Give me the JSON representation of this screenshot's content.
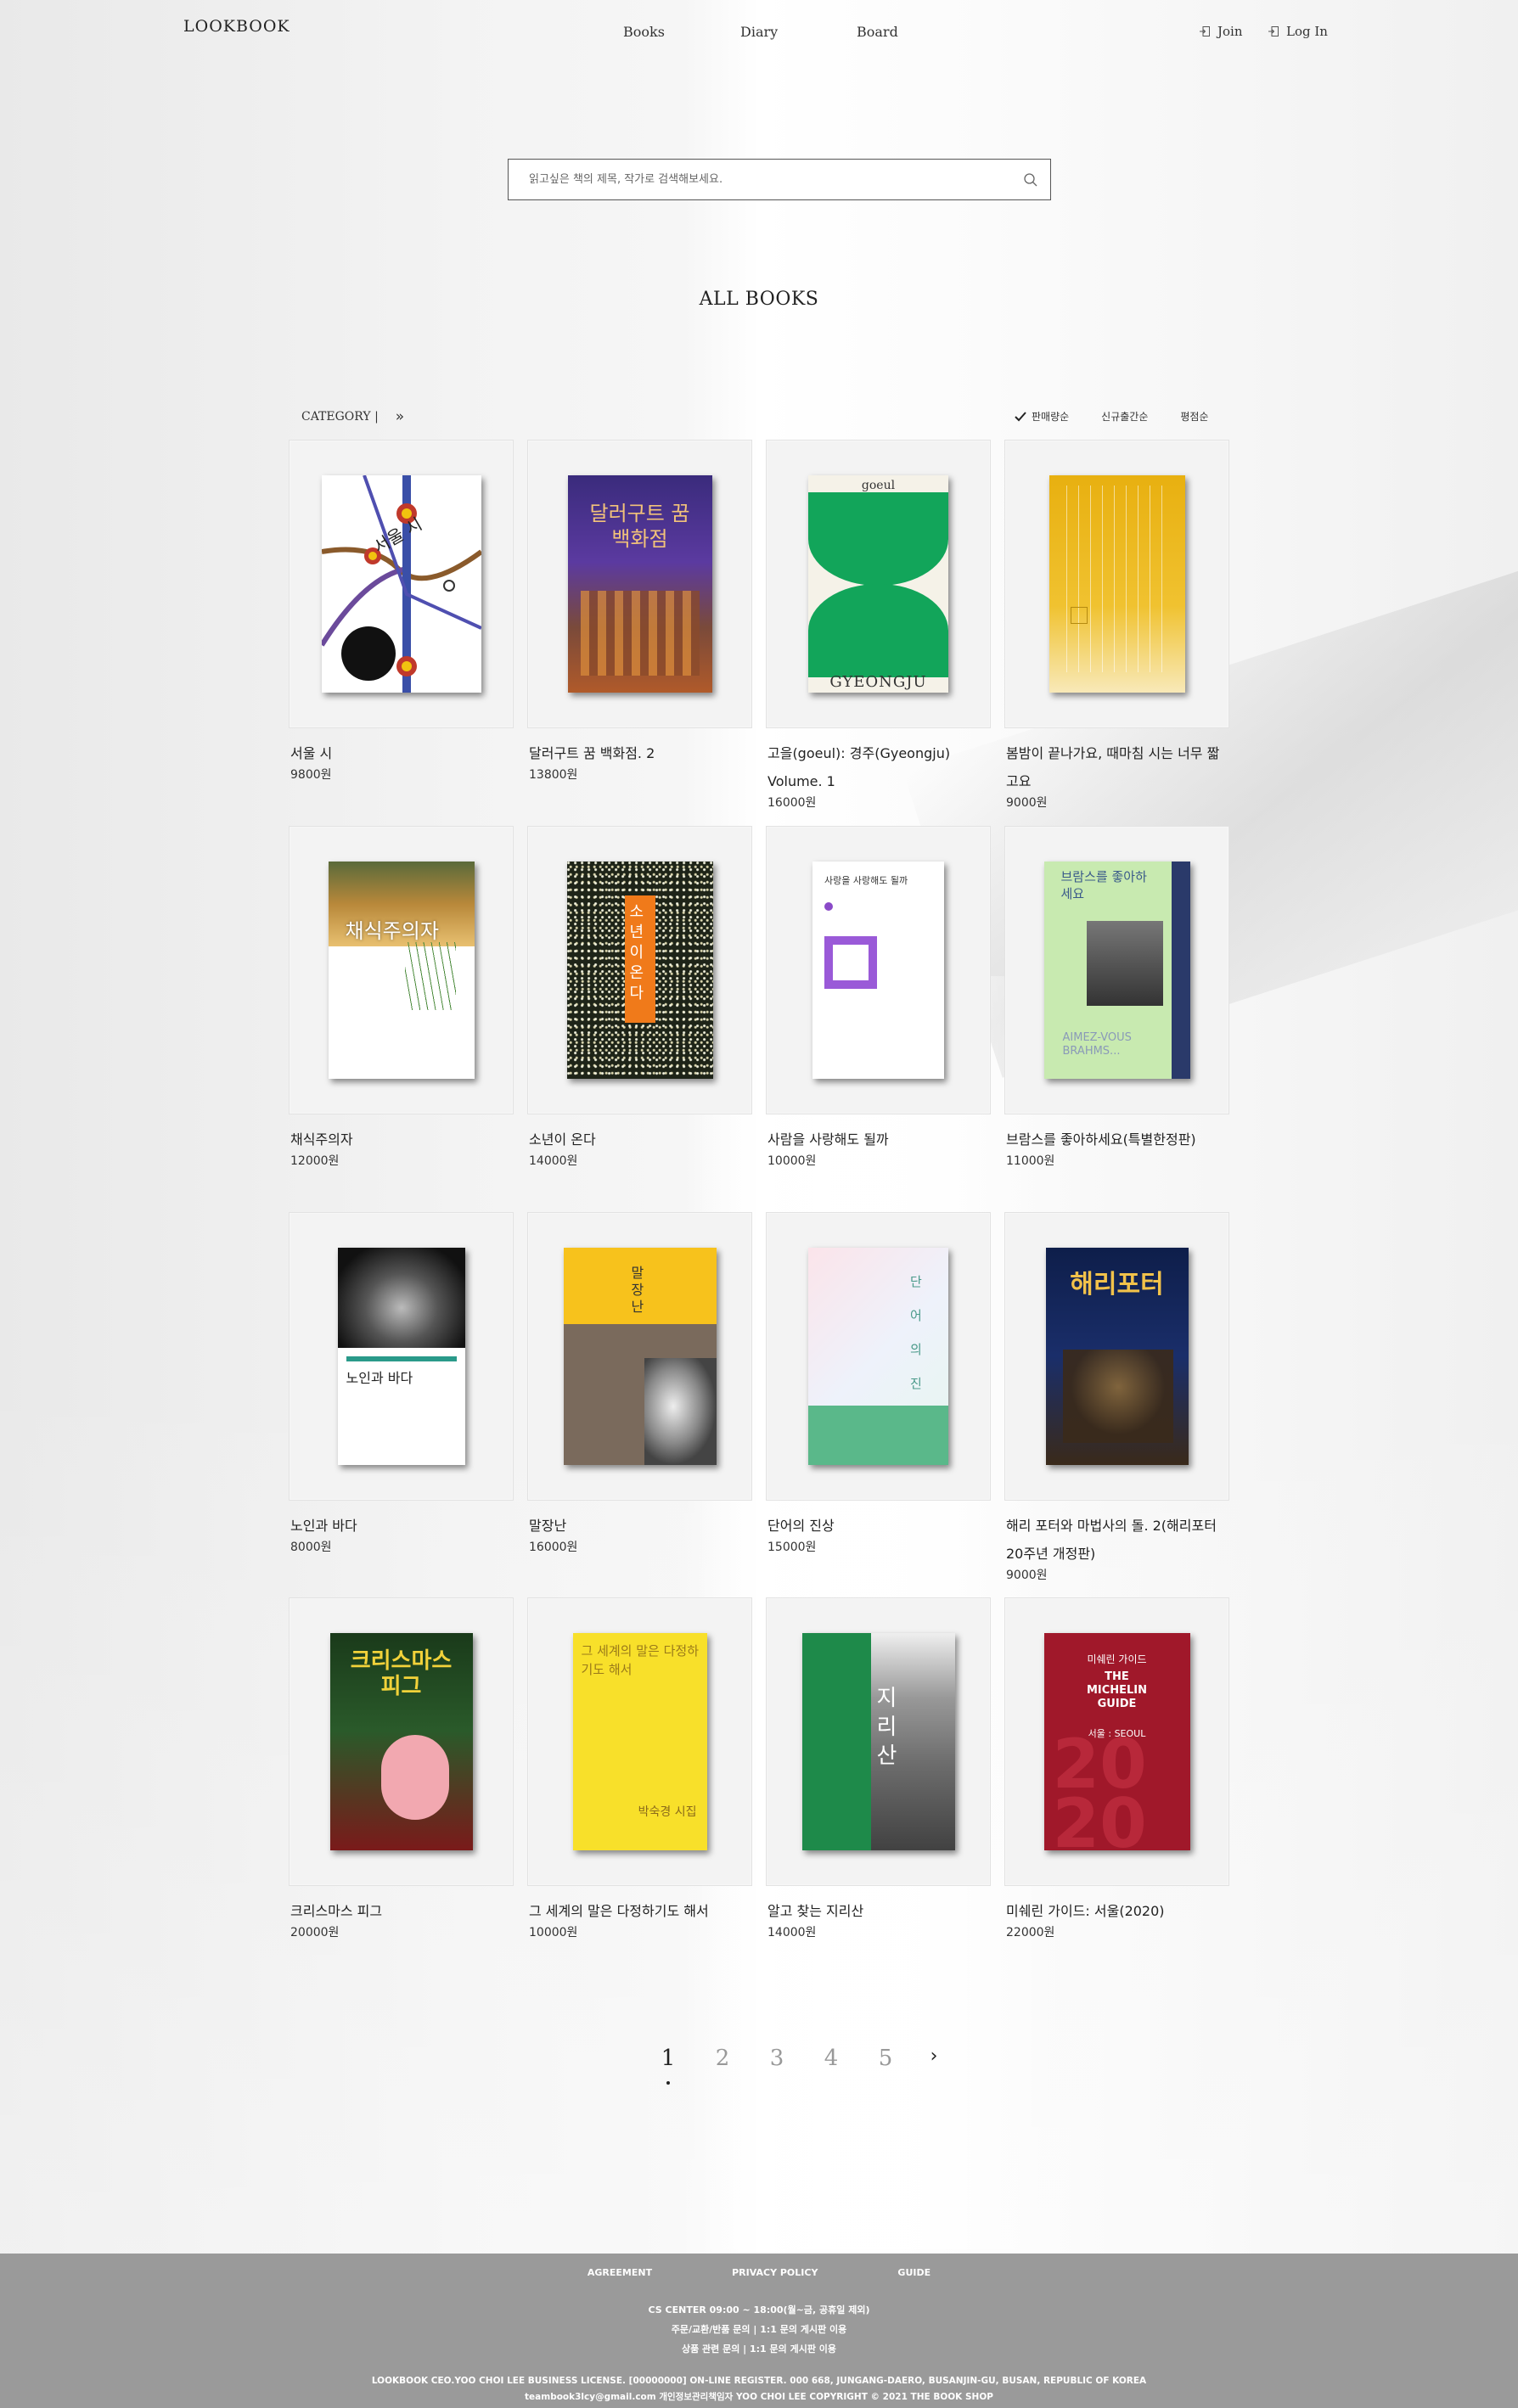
{
  "header": {
    "logo": "LOOKBOOK",
    "nav": [
      "Books",
      "Diary",
      "Board"
    ],
    "join": "Join",
    "login": "Log In"
  },
  "search": {
    "placeholder": "읽고싶은 책의 제목, 작가로 검색해보세요."
  },
  "section_title": "ALL BOOKS",
  "category": {
    "label": "CATEGORY |",
    "arrow": "»"
  },
  "sorts": [
    {
      "label": "판매량순",
      "selected": true
    },
    {
      "label": "신규출간순",
      "selected": false
    },
    {
      "label": "평점순",
      "selected": false
    }
  ],
  "books": [
    {
      "title": "서울 시",
      "price": "9800원",
      "cover": "seoul"
    },
    {
      "title": "달러구트 꿈 백화점. 2",
      "price": "13800원",
      "cover": "dallergut"
    },
    {
      "title": "고을(goeul): 경주(Gyeongju) Volume. 1",
      "price": "16000원",
      "cover": "gyeongju"
    },
    {
      "title": "봄밤이 끝나가요, 때마침 시는 너무 짧고요",
      "price": "9000원",
      "cover": "spring"
    },
    {
      "title": "채식주의자",
      "price": "12000원",
      "cover": "vegetarian"
    },
    {
      "title": "소년이 온다",
      "price": "14000원",
      "cover": "boy"
    },
    {
      "title": "사람을 사랑해도 될까",
      "price": "10000원",
      "cover": "love"
    },
    {
      "title": "브람스를 좋아하세요(특별한정판)",
      "price": "11000원",
      "cover": "brahms"
    },
    {
      "title": "노인과 바다",
      "price": "8000원",
      "cover": "oldman"
    },
    {
      "title": "말장난",
      "price": "16000원",
      "cover": "pun"
    },
    {
      "title": "단어의 진상",
      "price": "15000원",
      "cover": "words"
    },
    {
      "title": "해리 포터와 마법사의 돌. 2(해리포터 20주년 개정판)",
      "price": "9000원",
      "cover": "harry"
    },
    {
      "title": "크리스마스 피그",
      "price": "20000원",
      "cover": "pig"
    },
    {
      "title": "그 세계의 말은 다정하기도 해서",
      "price": "10000원",
      "cover": "world"
    },
    {
      "title": "알고 찾는 지리산",
      "price": "14000원",
      "cover": "jirisan"
    },
    {
      "title": "미쉐린 가이드: 서울(2020)",
      "price": "22000원",
      "cover": "michelin"
    }
  ],
  "covers_text": {
    "seoul_title": "서울 시",
    "dallergut_title": "달러구트 꿈 백화점",
    "gyeongju_top": "goeul",
    "gyeongju_bottom": "GYEONGJU",
    "vegetarian_title": "채식주의자",
    "boy_title": "소년이 온다",
    "love_title": "사랑을 사랑해도 될까",
    "brahms_title": "브람스를 좋아하세요",
    "brahms_sub": "AIMEZ-VOUS BRAHMS...",
    "oldman_title": "노인과 바다",
    "pun_title": "말장난",
    "words_title": "단어의 진상",
    "harry_title": "해리포터",
    "pig_title": "크리스마스 피그",
    "world_title": "그 세계의 말은 다정하기도 해서",
    "world_author": "박숙경 시집",
    "jirisan_title": "지리산",
    "michelin_title": "THE MICHELIN GUIDE",
    "michelin_kr": "미쉐린 가이드",
    "michelin_city": "서울 : SEOUL"
  },
  "pagination": {
    "pages": [
      "1",
      "2",
      "3",
      "4",
      "5"
    ],
    "active": "1",
    "next": "›"
  },
  "footer": {
    "links": [
      "AGREEMENT",
      "PRIVACY POLICY",
      "GUIDE"
    ],
    "cs": [
      "CS CENTER 09:00 ~ 18:00(월~금, 공휴일 제외)",
      "주문/교환/반품 문의 | 1:1 문의 게시판 이용",
      "상품 관련 문의 | 1:1 문의 게시판 이용"
    ],
    "bottom": [
      "LOOKBOOK CEO.YOO CHOI LEE BUSINESS LICENSE. [00000000] ON-LINE REGISTER. 000 668, JUNGANG-DAERO, BUSANJIN-GU, BUSAN, REPUBLIC OF KOREA",
      "teambook3lcy@gmail.com 개인정보관리책임자 YOO CHOI LEE COPYRIGHT © 2021 THE BOOK SHOP"
    ]
  },
  "colors": {
    "footer_bg": "#9a9a9a",
    "page_bg": "#efefef"
  }
}
